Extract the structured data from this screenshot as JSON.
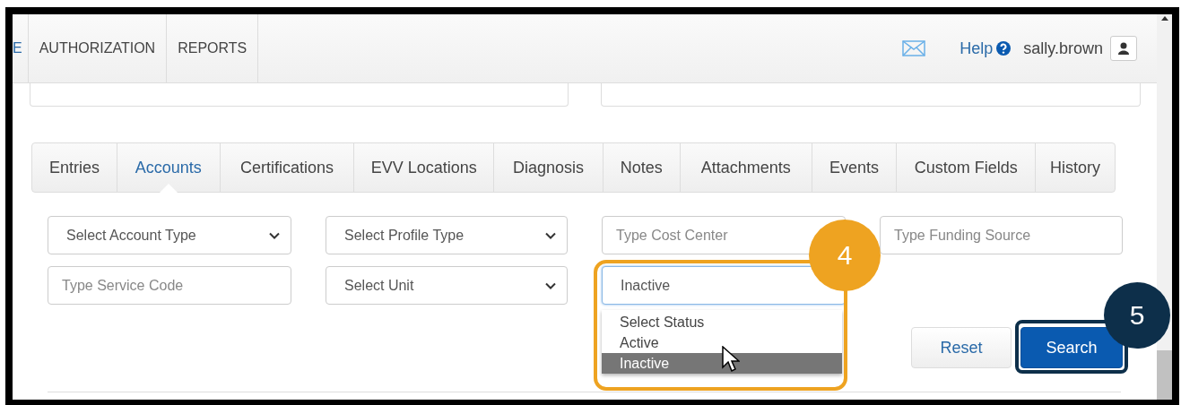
{
  "nav": {
    "items": [
      {
        "label": "E",
        "selected": true
      },
      {
        "label": "AUTHORIZATION",
        "selected": false
      },
      {
        "label": "REPORTS",
        "selected": false
      }
    ],
    "help": "Help",
    "user": "sally.brown"
  },
  "tabs": [
    {
      "label": "Entries",
      "selected": false
    },
    {
      "label": "Accounts",
      "selected": true
    },
    {
      "label": "Certifications",
      "selected": false
    },
    {
      "label": "EVV Locations",
      "selected": false
    },
    {
      "label": "Diagnosis",
      "selected": false
    },
    {
      "label": "Notes",
      "selected": false
    },
    {
      "label": "Attachments",
      "selected": false
    },
    {
      "label": "Events",
      "selected": false
    },
    {
      "label": "Custom Fields",
      "selected": false
    },
    {
      "label": "History",
      "selected": false
    }
  ],
  "filters": [
    {
      "kind": "select",
      "value": "Select Account Type",
      "focused": false
    },
    {
      "kind": "select",
      "value": "Select Profile Type",
      "focused": false
    },
    {
      "kind": "text",
      "placeholder": "Type Cost Center",
      "focused": false
    },
    {
      "kind": "text",
      "placeholder": "Type Funding Source",
      "focused": false
    },
    {
      "kind": "text",
      "placeholder": "Type Service Code",
      "focused": false
    },
    {
      "kind": "select",
      "value": "Select Unit",
      "focused": false
    },
    {
      "kind": "select",
      "value": "Inactive",
      "focused": true,
      "options": [
        {
          "label": "Select Status",
          "selected": false
        },
        {
          "label": "Active",
          "selected": false
        },
        {
          "label": "Inactive",
          "selected": true
        }
      ]
    }
  ],
  "buttons": [
    {
      "label": "Reset",
      "kind": "default"
    },
    {
      "label": "Search",
      "kind": "primary"
    }
  ],
  "callouts": [
    {
      "label": "4",
      "kind": "orange"
    },
    {
      "label": "5",
      "kind": "navy"
    }
  ]
}
